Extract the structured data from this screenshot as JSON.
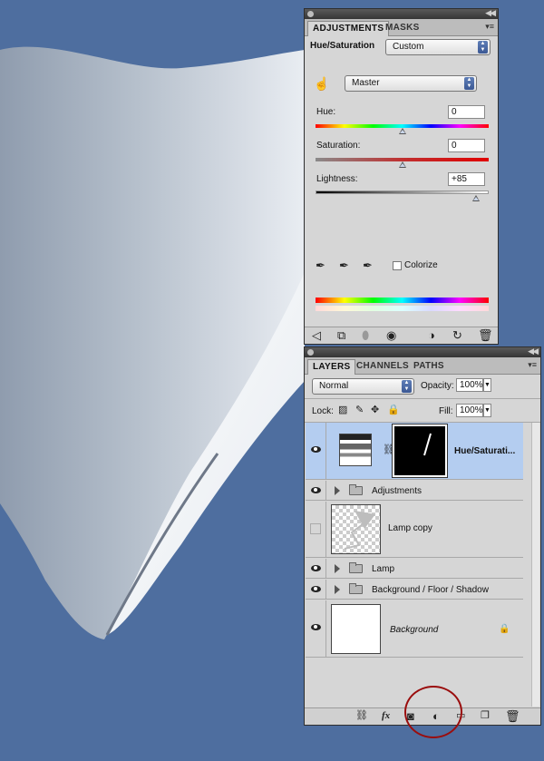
{
  "adjustments_panel": {
    "tabs": [
      "ADJUSTMENTS",
      "MASKS"
    ],
    "header_title": "Hue/Saturation",
    "preset_value": "Custom",
    "channel_value": "Master",
    "hue": {
      "label": "Hue:",
      "value": "0",
      "level": 0.5
    },
    "saturation": {
      "label": "Saturation:",
      "value": "0",
      "level": 0.5
    },
    "lightness": {
      "label": "Lightness:",
      "value": "+85",
      "level": 0.925
    },
    "colorize_label": "Colorize",
    "colorize_checked": false,
    "footer_icons": [
      "back-arrow-icon",
      "expand-view-icon",
      "clip-to-layer-icon",
      "visibility-eye-icon",
      "view-previous-state-icon",
      "reset-icon",
      "trash-icon"
    ]
  },
  "layers_panel": {
    "tabs": [
      "LAYERS",
      "CHANNELS",
      "PATHS"
    ],
    "blend_mode": "Normal",
    "opacity_label": "Opacity:",
    "opacity_value": "100%",
    "lock_label": "Lock:",
    "fill_label": "Fill:",
    "fill_value": "100%",
    "layers": [
      {
        "name": "Hue/Saturati...",
        "type": "adjustment",
        "visible": true,
        "selected": true
      },
      {
        "name": "Adjustments",
        "type": "group",
        "visible": true
      },
      {
        "name": "Lamp copy",
        "type": "layer",
        "visible": false
      },
      {
        "name": "Lamp",
        "type": "group",
        "visible": true
      },
      {
        "name": "Background / Floor / Shadow",
        "type": "group",
        "visible": true
      },
      {
        "name": "Background",
        "type": "background",
        "visible": true,
        "locked": true
      }
    ],
    "footer_icons": [
      "link-layers-icon",
      "fx-icon",
      "add-mask-icon",
      "new-adjustment-layer-icon",
      "new-group-icon",
      "new-layer-icon",
      "trash-icon"
    ],
    "highlighted_icon": "new-adjustment-layer-icon"
  },
  "colors": {
    "canvas_background": "#4e6e9f",
    "selection": "#b4cdf0",
    "highlight_circle": "#9a0d0d"
  }
}
